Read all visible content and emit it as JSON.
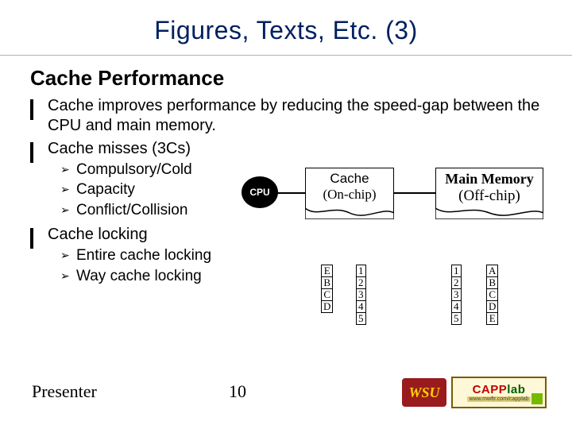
{
  "title": "Figures, Texts, Etc. (3)",
  "section": "Cache Performance",
  "bullets": {
    "b1": "Cache improves performance by reducing the speed-gap between the CPU and main memory.",
    "b2": "Cache misses (3Cs)",
    "b2_sub": {
      "s1": "Compulsory/Cold",
      "s2": "Capacity",
      "s3": "Conflict/Collision"
    },
    "b3": "Cache locking",
    "b3_sub": {
      "s1": "Entire cache locking",
      "s2": "Way cache locking"
    }
  },
  "diagram": {
    "cpu": "CPU",
    "cache": {
      "label": "Cache",
      "sub": "(On-chip)"
    },
    "main_memory": {
      "label": "Main Memory",
      "sub": "(Off-chip)"
    },
    "cache_table": {
      "col1": [
        "E",
        "B",
        "C",
        "D"
      ],
      "col2": [
        "1",
        "2",
        "3",
        "4",
        "5"
      ]
    },
    "mm_table": {
      "col1": [
        "1",
        "2",
        "3",
        "4",
        "5"
      ],
      "col2": [
        "A",
        "B",
        "C",
        "D",
        "E"
      ]
    }
  },
  "footer": {
    "presenter": "Presenter",
    "page": "10",
    "wsu": "WSU",
    "capplab": "CAPPlab",
    "capptag": "www.mwftr.com/capplab"
  }
}
